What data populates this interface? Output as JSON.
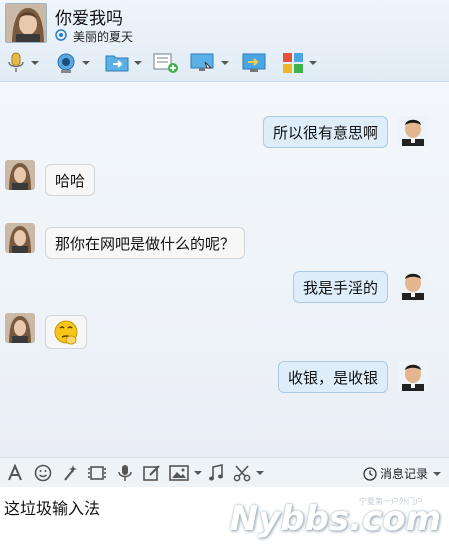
{
  "header": {
    "contact_name": "你爱我吗",
    "contact_status": "美丽的夏天"
  },
  "toolbar": {
    "icons": [
      "microphone-icon",
      "video-camera-icon",
      "send-file-icon",
      "add-note-icon",
      "screen-share-icon",
      "remote-assist-icon",
      "apps-grid-icon"
    ]
  },
  "messages": [
    {
      "side": "right",
      "text": "所以很有意思啊"
    },
    {
      "side": "left",
      "text": "哈哈"
    },
    {
      "side": "left",
      "text": "那你在网吧是做什么的呢？"
    },
    {
      "side": "right",
      "text": "我是手淫的"
    },
    {
      "side": "left",
      "text": "",
      "emoji": "thinking-face-icon"
    },
    {
      "side": "right",
      "text": "收银，是收银"
    }
  ],
  "input_toolbar": {
    "icons": [
      "font-icon",
      "emoji-icon",
      "magic-wand-icon",
      "screenshot-icon",
      "voice-icon",
      "handwriting-icon",
      "image-icon",
      "music-icon",
      "scissors-icon"
    ],
    "history_label": "消息记录"
  },
  "input": {
    "value": "这垃圾输入法"
  },
  "watermark": {
    "text": "Nybbs.com",
    "subtext": "宁夏第一户外门户"
  },
  "colors": {
    "bubble_right": "#ddeefa",
    "bubble_left": "#f7f7f7",
    "chat_bg": "#eef3f8"
  }
}
